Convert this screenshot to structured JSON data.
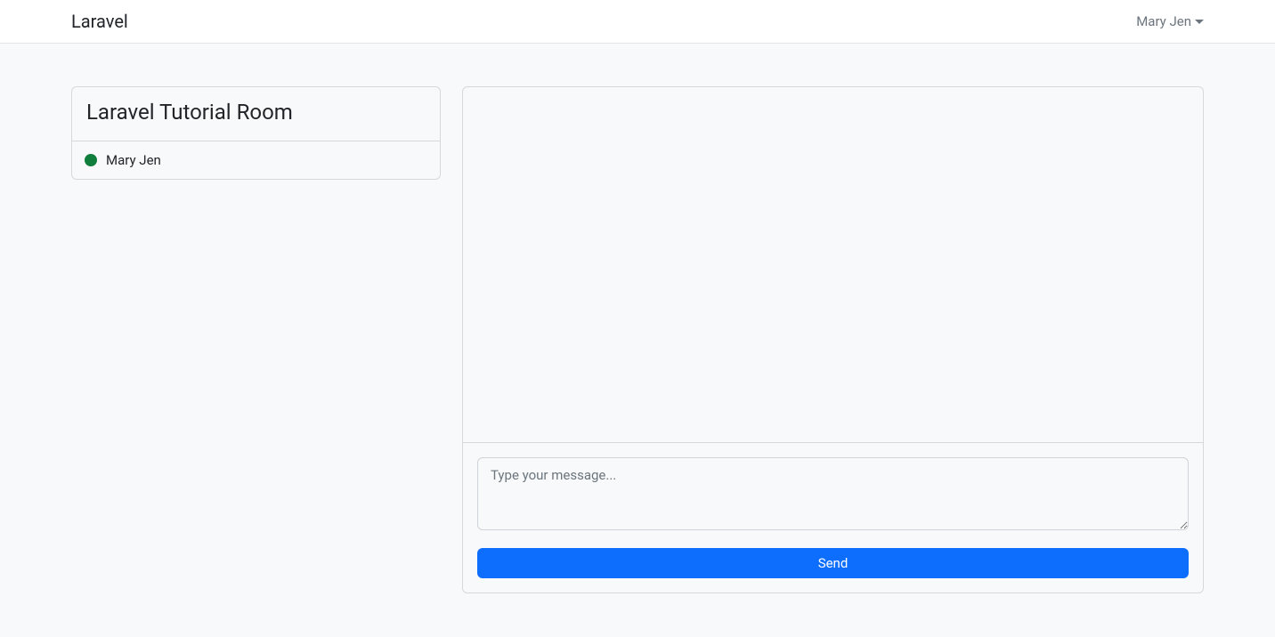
{
  "navbar": {
    "brand": "Laravel",
    "user_name": "Mary Jen"
  },
  "sidebar": {
    "room_title": "Laravel Tutorial Room",
    "users": [
      {
        "name": "Mary Jen",
        "status": "online"
      }
    ]
  },
  "chat": {
    "message_placeholder": "Type your message...",
    "send_label": "Send"
  }
}
